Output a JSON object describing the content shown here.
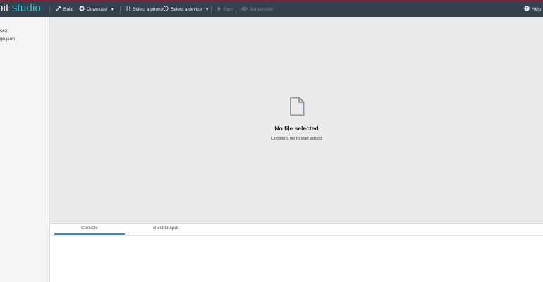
{
  "app": {
    "logo_prefix": "bit",
    "logo_suffix": "studio"
  },
  "toolbar": {
    "build_label": "Build",
    "download_label": "Download",
    "select_phone_label": "Select a phone",
    "select_device_label": "Select a device",
    "run_label": "Run",
    "screenshot_label": "Screenshot",
    "help_label": "Help"
  },
  "sidebar": {
    "items": [
      {
        "label": "ces"
      },
      {
        "label": "ge.json"
      }
    ]
  },
  "editor": {
    "empty_title": "No file selected",
    "empty_subtitle": "Choose a file to start editing"
  },
  "bottom_panel": {
    "tabs": [
      {
        "label": "Console",
        "active": true
      },
      {
        "label": "Build Output",
        "active": false
      }
    ]
  },
  "colors": {
    "topbar": "#36414f",
    "accent": "#39c3c9",
    "tab_active": "#3a8fb7",
    "editor_bg": "#ebebeb"
  }
}
